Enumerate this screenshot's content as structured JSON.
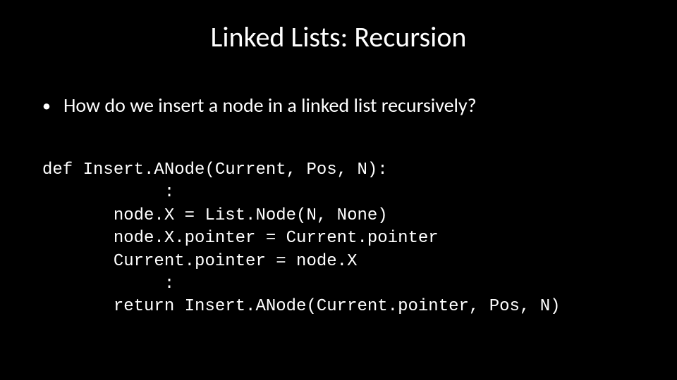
{
  "title": "Linked Lists: Recursion",
  "bullet": {
    "dot": "•",
    "text": "How do we insert a node in a linked list recursively?"
  },
  "code": {
    "l1": "def Insert.ANode(Current, Pos, N):",
    "l2": "            :",
    "l3": "       node.X = List.Node(N, None)",
    "l4": "       node.X.pointer = Current.pointer",
    "l5": "       Current.pointer = node.X",
    "l6": "            :",
    "l7": "       return Insert.ANode(Current.pointer, Pos, N)"
  }
}
